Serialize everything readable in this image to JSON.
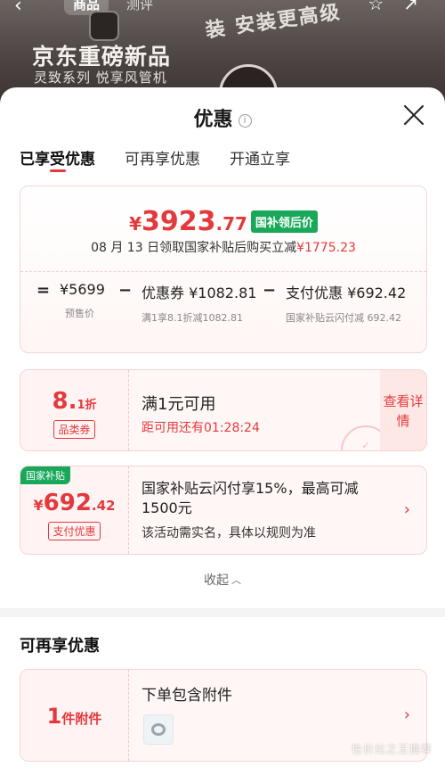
{
  "background": {
    "tabs": [
      "商品",
      "测评"
    ],
    "slogan": "装 安装更高级",
    "title": "京东重磅新品",
    "subtitle": "灵致系列 悦享风管机"
  },
  "sheet": {
    "title": "优惠",
    "tabs": [
      {
        "label": "已享受优惠",
        "active": true
      },
      {
        "label": "可再享优惠",
        "active": false
      },
      {
        "label": "开通立享",
        "active": false
      }
    ]
  },
  "price": {
    "currency": "¥",
    "final_int": "3923",
    "final_dec": ".77",
    "badge": "国补领后价",
    "desc_prefix": "08 月 13 日领取国家补贴后购买立减",
    "desc_amount": "¥1775.23",
    "breakdown": [
      {
        "op": "=",
        "main": "¥5699",
        "sub": "预售价"
      },
      {
        "op": "−",
        "main": "优惠券 ¥1082.81",
        "sub": "满1享8.1折减1082.81"
      },
      {
        "op": "−",
        "main": "支付优惠 ¥692.42",
        "sub": "国家补贴云闪付减 692.42"
      }
    ]
  },
  "coupon1": {
    "value": "8.",
    "value_small": "1折",
    "tag": "品类券",
    "condition": "满1元可用",
    "countdown": "距可用还有01:28:24",
    "more": "查看详情"
  },
  "coupon2": {
    "badge": "国家补贴",
    "currency": "¥",
    "value": "692",
    "value_dec": ".42",
    "tag": "支付优惠",
    "text": "国家补贴云闪付享15%，最高可减1500元",
    "note": "该活动需实名，具体以规则为准"
  },
  "collapse_label": "收起",
  "section2": {
    "title": "可再享优惠",
    "coupon": {
      "value": "1",
      "value_unit": "件附件",
      "text": "下单包含附件"
    }
  },
  "watermark": "性价比之王推荐",
  "colors": {
    "accent": "#e4393c",
    "green": "#19a85a"
  }
}
